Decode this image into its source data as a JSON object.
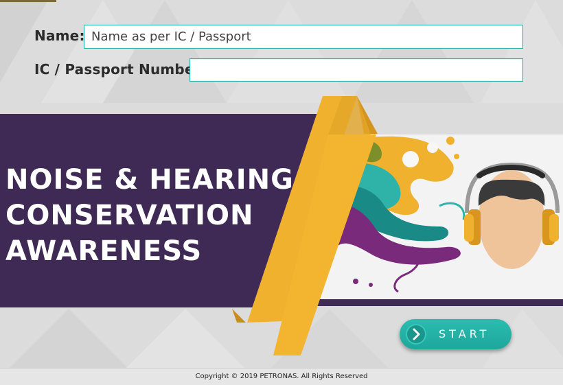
{
  "form": {
    "name_label": "Name:",
    "name_placeholder": "Name as per IC / Passport",
    "name_value": "",
    "id_label": "IC / Passport Number:",
    "id_placeholder": "",
    "id_value": ""
  },
  "banner": {
    "title_lines": [
      "NOISE & HEARING",
      "CONSERVATION",
      "AWARENESS"
    ]
  },
  "start": {
    "label": "START",
    "icon": "chevron-right-icon"
  },
  "footer": {
    "copyright": "Copyright © 2019 PETRONAS. All Rights Reserved"
  },
  "colors": {
    "purple": "#3f2a55",
    "gold": "#f0b22e",
    "teal": "#2bbcb0",
    "background": "#dcdcdc"
  }
}
